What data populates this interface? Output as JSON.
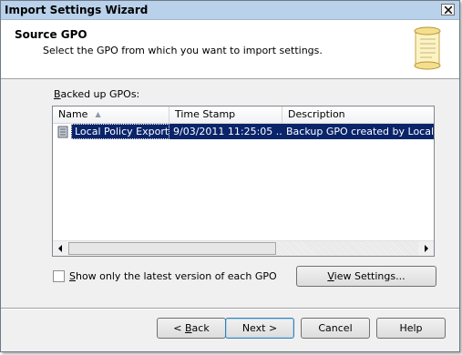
{
  "window": {
    "title": "Import Settings Wizard"
  },
  "header": {
    "title": "Source GPO",
    "subtitle": "Select the GPO from which you want to import settings.",
    "icon": "scroll-icon"
  },
  "list": {
    "label_prefix": "B",
    "label_rest": "acked up GPOs:",
    "columns": [
      "Name",
      "Time Stamp",
      "Description"
    ],
    "sort_column": "Name",
    "rows": [
      {
        "name": "Local Policy Export",
        "timestamp": "9/03/2011 11:25:05 ...",
        "description": "Backup GPO created by LocalGPO",
        "selected": true
      }
    ]
  },
  "checkbox": {
    "label_prefix": "S",
    "label_rest": "how only the latest version of each GPO",
    "checked": false
  },
  "buttons": {
    "view_settings_prefix": "V",
    "view_settings_rest": "iew Settings...",
    "back_prefix": "< ",
    "back_accel": "B",
    "back_rest": "ack",
    "next": "Next >",
    "cancel": "Cancel",
    "help": "Help"
  },
  "colors": {
    "selection": "#0a246a",
    "titlebar": "#b9d1ea",
    "dialog_bg": "#f0f0f0"
  }
}
